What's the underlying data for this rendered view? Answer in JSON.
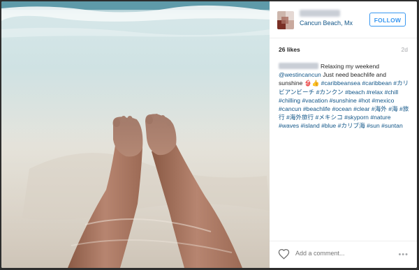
{
  "post": {
    "location": "Cancun Beach, Mx",
    "follow_label": "FOLLOW",
    "likes": "26 likes",
    "age": "2d",
    "caption": {
      "text_1": "Relaxing my weekend",
      "mention": "@westincancun",
      "text_2": "Just need beachlife and sunshine",
      "emoji": "👙👍",
      "hashtags": [
        "#caribbeansea",
        "#caribbean",
        "#カリビアンビーチ",
        "#カンクン",
        "#beach",
        "#relax",
        "#chill",
        "#chilling",
        "#vacation",
        "#sunshine",
        "#hot",
        "#mexico",
        "#cancun",
        "#beachlife",
        "#ocean",
        "#clear",
        "#海外",
        "#海",
        "#旅行",
        "#海外旅行",
        "#メキシコ",
        "#skyporn",
        "#nature",
        "#waves",
        "#island",
        "#blue",
        "#カリブ海",
        "#sun",
        "#suntan"
      ]
    },
    "comment_placeholder": "Add a comment...",
    "more_label": "•••",
    "icons": {
      "like": "heart-outline-icon",
      "more": "more-options-icon"
    },
    "colors": {
      "link": "#125688",
      "follow": "#3897f0",
      "text": "#262626",
      "muted": "#a5a7aa"
    }
  }
}
